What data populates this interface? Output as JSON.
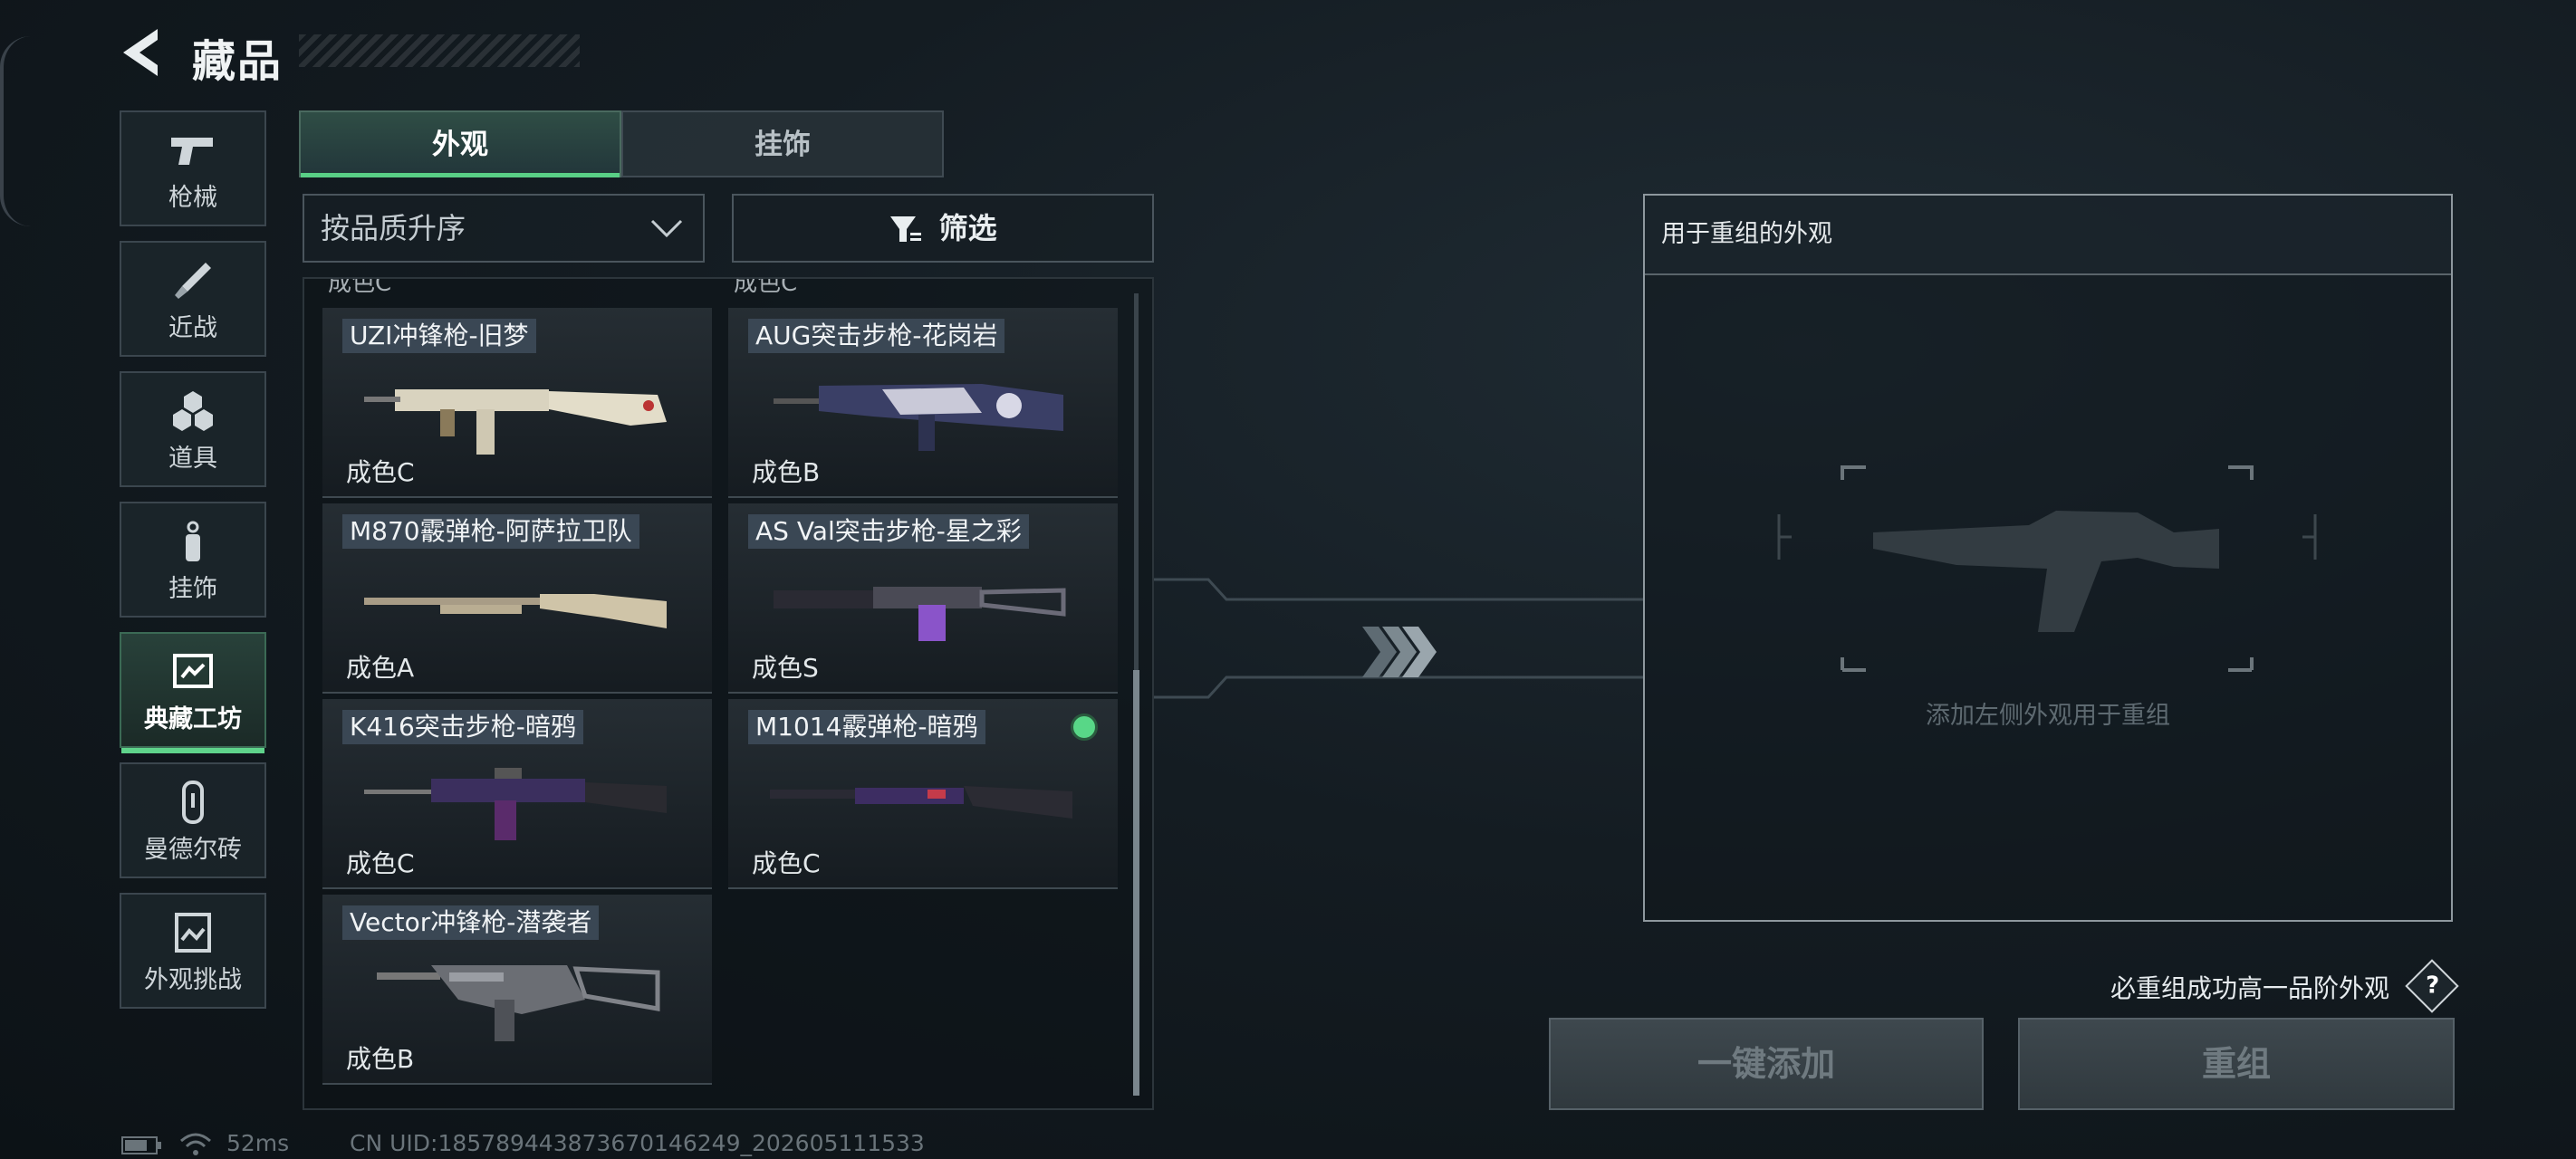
{
  "header": {
    "title": "藏品"
  },
  "sidebar": {
    "items": [
      {
        "label": "枪械",
        "icon": "pistol-icon"
      },
      {
        "label": "近战",
        "icon": "knife-icon"
      },
      {
        "label": "道具",
        "icon": "grenade-icon"
      },
      {
        "label": "挂饰",
        "icon": "charm-icon"
      },
      {
        "label": "典藏工坊",
        "icon": "workshop-icon",
        "active": true
      },
      {
        "label": "曼德尔砖",
        "icon": "mandel-brick-icon"
      },
      {
        "label": "外观挑战",
        "icon": "challenge-icon"
      }
    ]
  },
  "tabs": [
    {
      "label": "外观",
      "active": true
    },
    {
      "label": "挂饰",
      "active": false
    }
  ],
  "sort": {
    "value": "按品质升序"
  },
  "filter": {
    "label": "筛选"
  },
  "list": {
    "partial_top": [
      "成色C",
      "成色C"
    ],
    "items": [
      {
        "name": "UZI冲锋枪-旧梦",
        "grade": "成色C",
        "icon": "uzi-icon",
        "selected": false
      },
      {
        "name": "AUG突击步枪-花岗岩",
        "grade": "成色B",
        "icon": "aug-icon",
        "selected": false
      },
      {
        "name": "M870霰弹枪-阿萨拉卫队",
        "grade": "成色A",
        "icon": "m870-icon",
        "selected": false
      },
      {
        "name": "AS Val突击步枪-星之彩",
        "grade": "成色S",
        "icon": "asval-icon",
        "selected": false
      },
      {
        "name": "K416突击步枪-暗鸦",
        "grade": "成色C",
        "icon": "k416-icon",
        "selected": false
      },
      {
        "name": "M1014霰弹枪-暗鸦",
        "grade": "成色C",
        "icon": "m1014-icon",
        "selected": true
      },
      {
        "name": "Vector冲锋枪-潜袭者",
        "grade": "成色B",
        "icon": "vector-icon",
        "selected": false
      }
    ]
  },
  "panel": {
    "title": "用于重组的外观",
    "hint": "添加左侧外观用于重组"
  },
  "note": "必重组成功高一品阶外观",
  "help": "?",
  "buttons": {
    "add_all": "一键添加",
    "recombine": "重组"
  },
  "footer": {
    "ping": "52ms",
    "uid": "CN UID:18578944387367014624​9_202605111533"
  },
  "colors": {
    "accent": "#58d787",
    "panel_border": "#8e989e"
  }
}
